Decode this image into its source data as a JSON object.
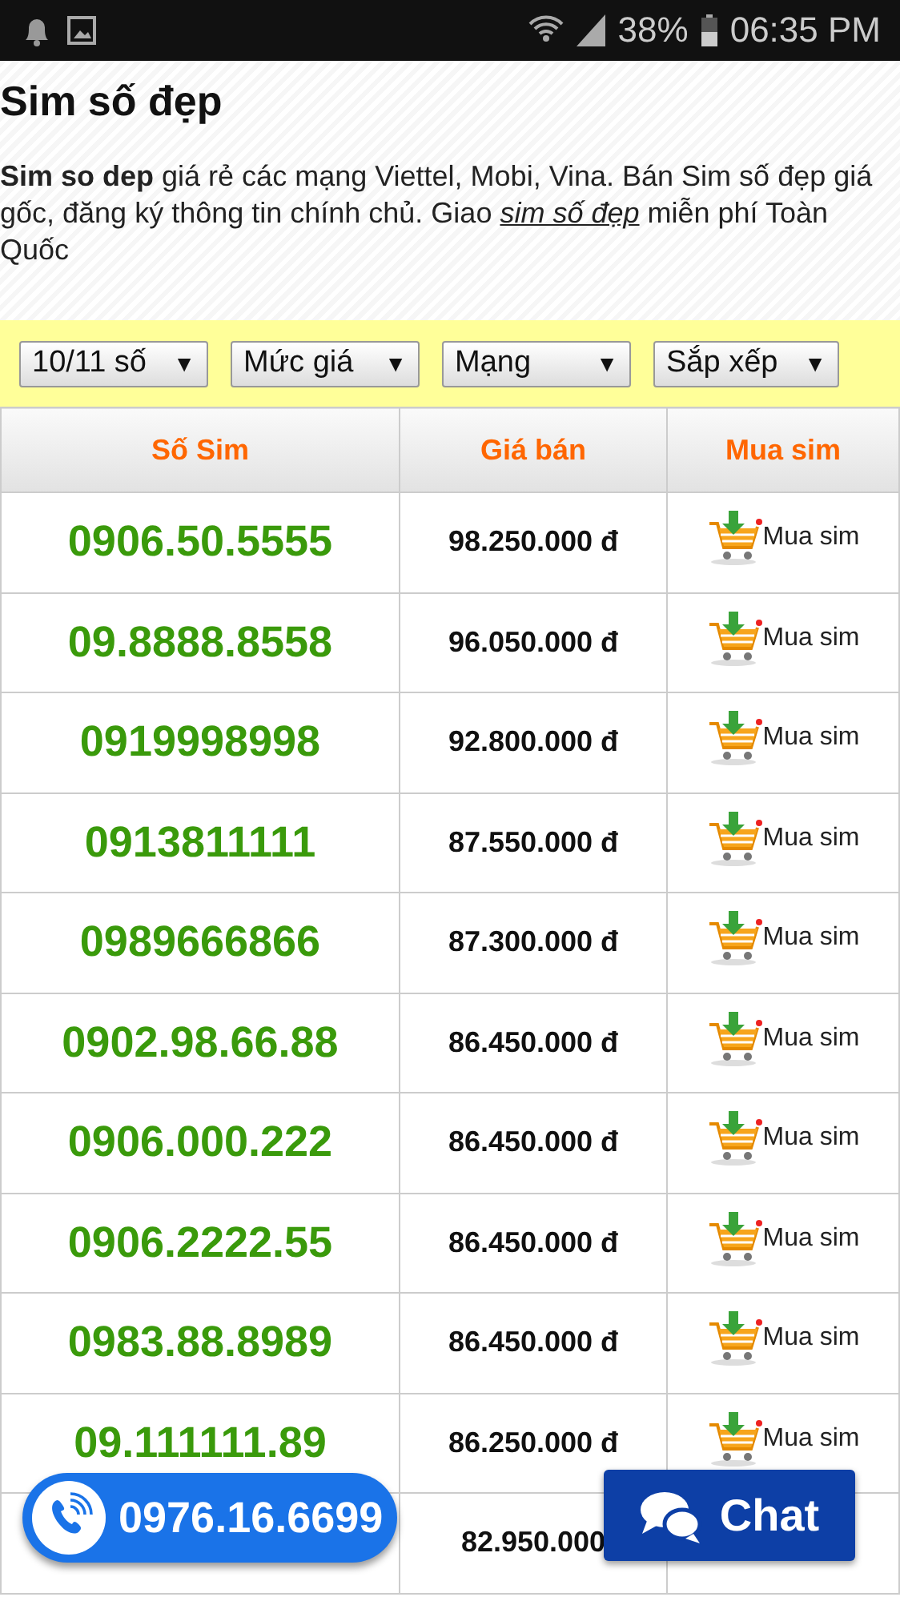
{
  "status_bar": {
    "battery": "38%",
    "time": "06:35 PM"
  },
  "title": "Sim số đẹp",
  "intro": {
    "before": "**Sim so dep** giá rẻ các mạng Viettel, Mobi, Vina. Bán Sim số đẹp giá gốc, đăng ký thông tin chính chủ. Giao ",
    "link": "sim số đẹp",
    "after": " miễn phí Toàn Quốc"
  },
  "filters": [
    {
      "label": "10/11 số",
      "arrow": "▼"
    },
    {
      "label": "Mức giá",
      "arrow": "▼"
    },
    {
      "label": "Mạng",
      "arrow": "▼"
    },
    {
      "label": "Sắp xếp",
      "arrow": "▼"
    }
  ],
  "table": {
    "columns": [
      "Số Sim",
      "Giá bán",
      "Mua sim"
    ],
    "rows": [
      {
        "number": "0906.50.5555",
        "price": "98.250.000 đ",
        "buy": "Mua sim"
      },
      {
        "number": "09.8888.8558",
        "price": "96.050.000 đ",
        "buy": "Mua sim"
      },
      {
        "number": "0919998998",
        "price": "92.800.000 đ",
        "buy": "Mua sim"
      },
      {
        "number": "0913811111",
        "price": "87.550.000 đ",
        "buy": "Mua sim"
      },
      {
        "number": "0989666866",
        "price": "87.300.000 đ",
        "buy": "Mua sim"
      },
      {
        "number": "0902.98.66.88",
        "price": "86.450.000 đ",
        "buy": "Mua sim"
      },
      {
        "number": "0906.000.222",
        "price": "86.450.000 đ",
        "buy": "Mua sim"
      },
      {
        "number": "0906.2222.55",
        "price": "86.450.000 đ",
        "buy": "Mua sim"
      },
      {
        "number": "0983.88.8989",
        "price": "86.450.000 đ",
        "buy": "Mua sim"
      },
      {
        "number": "09.111111.89",
        "price": "86.250.000 đ",
        "buy": "Mua sim"
      },
      {
        "price": "82.950.000"
      }
    ]
  },
  "call_button": {
    "phone": "0976.16.6699"
  },
  "chat_button": {
    "label": "Chat"
  }
}
